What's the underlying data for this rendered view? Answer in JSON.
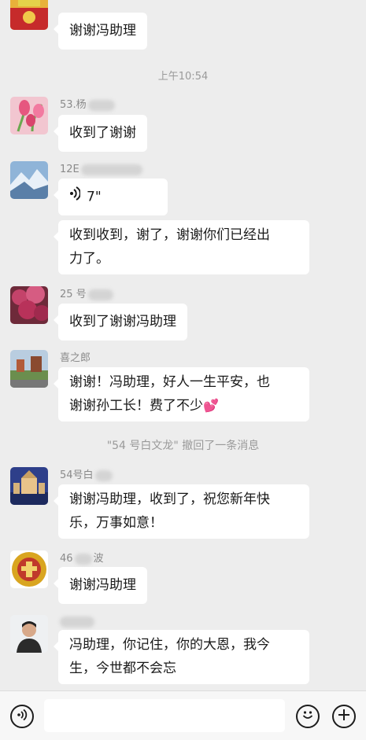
{
  "messages": [
    {
      "name": "",
      "text": "谢谢冯助理"
    },
    {
      "time": "上午10:54"
    },
    {
      "name": "53.杨",
      "text": "收到了谢谢"
    },
    {
      "name": "12E",
      "voice_duration": "7\"",
      "text": "收到收到，谢了，谢谢你们已经出力了。",
      "text_line1": "收到收到，谢了，谢谢你们已经出",
      "text_line2": "力了。"
    },
    {
      "name": "25 号",
      "text": "收到了谢谢冯助理"
    },
    {
      "name": "喜之郎",
      "text_line1": "谢谢！冯助理，好人一生平安，也",
      "text_line2": "谢谢孙工长！费了不少"
    },
    {
      "system": "\"54 号白文龙\" 撤回了一条消息"
    },
    {
      "name": "54号白",
      "text_line1": "谢谢冯助理，收到了，祝您新年快",
      "text_line2": "乐，万事如意！"
    },
    {
      "name": "46",
      "name_suffix": "波",
      "text": "谢谢冯助理"
    },
    {
      "name": "",
      "text_line1": "冯助理，你记住，你的大恩，我今",
      "text_line2": "生，今世都不会忘"
    }
  ],
  "emoji": "💕",
  "icons": {
    "voice_input": "voice-input-icon",
    "emoji_button": "emoji-face-icon",
    "more_button": "plus-icon",
    "voice_bubble": "voice-wave-icon"
  },
  "colors": {
    "background": "#ededed",
    "bubble": "#ffffff",
    "name_text": "#8a8a8a",
    "system_text": "#9a9a9a"
  }
}
